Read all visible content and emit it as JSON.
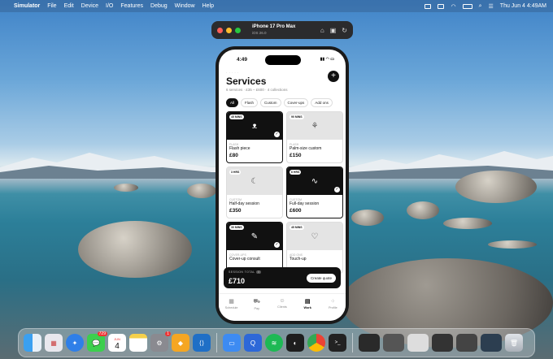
{
  "menubar": {
    "app": "Simulator",
    "items": [
      "File",
      "Edit",
      "Device",
      "I/O",
      "Features",
      "Debug",
      "Window",
      "Help"
    ],
    "clock": "Thu Jun 4  4:49AM"
  },
  "simulator": {
    "device": "iPhone 17 Pro Max",
    "os": "iOS 26.0"
  },
  "phone": {
    "time": "4:49"
  },
  "app": {
    "title": "Services",
    "subtitle": "6 services · £35 – £600 · 4 collections",
    "filters": [
      {
        "label": "All",
        "active": true
      },
      {
        "label": "Flash",
        "active": false
      },
      {
        "label": "Custom",
        "active": false
      },
      {
        "label": "Cover-ups",
        "active": false
      },
      {
        "label": "Add ons",
        "active": false
      }
    ],
    "cards": [
      {
        "duration": "45 MINS",
        "category": "FLASH",
        "name": "Flash piece",
        "price": "£80",
        "dark": true,
        "selected": true,
        "icon": "flash-tattoo-icon"
      },
      {
        "duration": "90 MINS",
        "category": "FLASH",
        "name": "Palm-size custom",
        "price": "£150",
        "dark": false,
        "selected": false,
        "icon": "palm-tattoo-icon"
      },
      {
        "duration": "3 HRS",
        "category": "CUSTOM",
        "name": "Half-day session",
        "price": "£350",
        "dark": false,
        "selected": false,
        "icon": "moon-icon"
      },
      {
        "duration": "6 HRS",
        "category": "CUSTOM",
        "name": "Full-day session",
        "price": "£600",
        "dark": true,
        "selected": true,
        "icon": "full-day-icon"
      },
      {
        "duration": "30 MINS",
        "category": "COVER-UPS",
        "name": "Cover-up consult",
        "price": "",
        "dark": true,
        "selected": true,
        "icon": "tattoo-pen-icon"
      },
      {
        "duration": "45 MINS",
        "category": "ADD ONS",
        "name": "Touch-up",
        "price": "",
        "dark": false,
        "selected": false,
        "icon": "touch-up-icon"
      }
    ],
    "session": {
      "label": "SESSION TOTAL",
      "count": "3",
      "total": "£710",
      "button": "Create quote"
    },
    "tabs": [
      {
        "label": "Schedule",
        "icon": "calendar-icon",
        "active": false
      },
      {
        "label": "Pay",
        "icon": "cart-icon",
        "active": false
      },
      {
        "label": "Clients",
        "icon": "people-icon",
        "active": false
      },
      {
        "label": "Work",
        "icon": "book-icon",
        "active": true
      },
      {
        "label": "Profile",
        "icon": "grid-icon",
        "active": false
      }
    ]
  },
  "dock": {
    "messages_badge": "729",
    "calendar_day": "4",
    "settings_badge": "1",
    "calendar_month": "JUN"
  }
}
